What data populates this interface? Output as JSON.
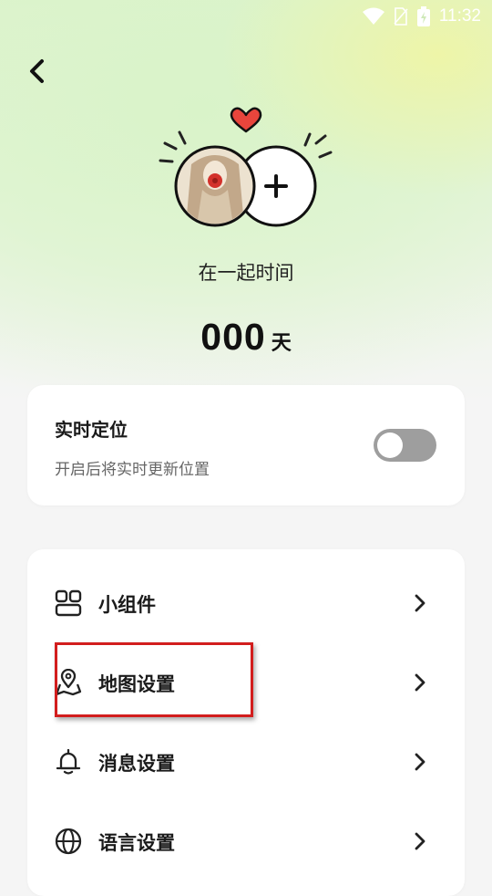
{
  "status_bar": {
    "time": "11:32",
    "icons": [
      "wifi-icon",
      "sim-icon",
      "battery-icon"
    ]
  },
  "header": {
    "back_icon": "chevron-left-icon"
  },
  "couple": {
    "title": "在一起时间",
    "days_value": "000",
    "days_unit": "天",
    "heart_color": "#e8453c",
    "add_icon": "plus-icon"
  },
  "location": {
    "title": "实时定位",
    "subtitle": "开启后将实时更新位置",
    "toggle_on": false
  },
  "menu": {
    "items": [
      {
        "label": "小组件",
        "icon": "widget-icon"
      },
      {
        "label": "地图设置",
        "icon": "map-pin-icon"
      },
      {
        "label": "消息设置",
        "icon": "bell-icon"
      },
      {
        "label": "语言设置",
        "icon": "globe-icon"
      }
    ]
  },
  "colors": {
    "accent_bg": "#dff3cf",
    "highlight": "#d21d1d",
    "toggle_off": "#9e9e9e"
  }
}
